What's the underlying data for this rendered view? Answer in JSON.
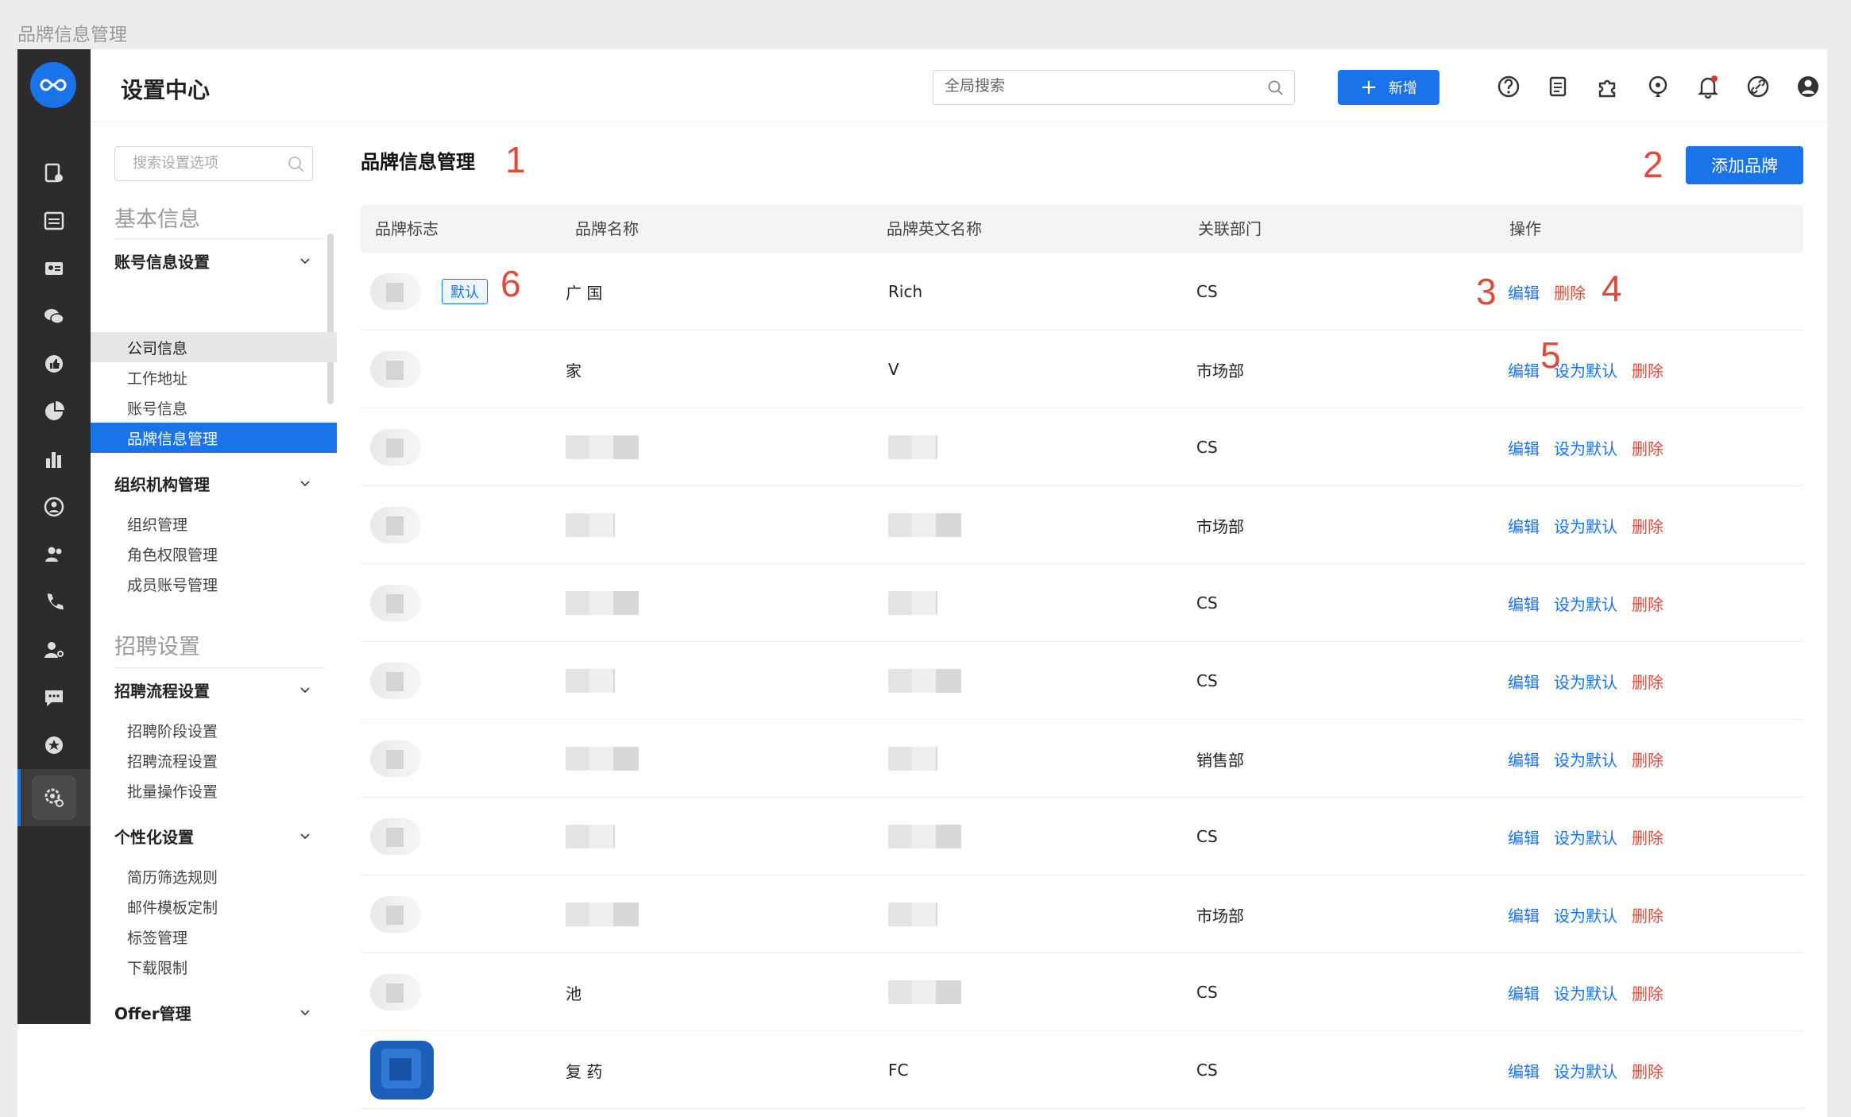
{
  "page_caption": "品牌信息管理",
  "header": {
    "title": "设置中心",
    "search_placeholder": "全局搜索",
    "new_button": "新增"
  },
  "sidebar": {
    "search_placeholder": "搜索设置选项",
    "groups": [
      {
        "title": "基本信息",
        "sections": [
          {
            "label": "账号信息设置",
            "items": [
              "公司信息",
              "工作地址",
              "账号信息",
              "品牌信息管理"
            ]
          },
          {
            "label": "组织机构管理",
            "items": [
              "组织管理",
              "角色权限管理",
              "成员账号管理"
            ]
          }
        ]
      },
      {
        "title": "招聘设置",
        "sections": [
          {
            "label": "招聘流程设置",
            "items": [
              "招聘阶段设置",
              "招聘流程设置",
              "批量操作设置"
            ]
          },
          {
            "label": "个性化设置",
            "items": [
              "简历筛选规则",
              "邮件模板定制",
              "标签管理",
              "下载限制"
            ]
          },
          {
            "label": "Offer管理",
            "items": []
          }
        ]
      }
    ]
  },
  "main": {
    "title": "品牌信息管理",
    "add_button": "添加品牌",
    "annotations": [
      "1",
      "2",
      "3",
      "4",
      "5",
      "6"
    ],
    "columns": [
      "品牌标志",
      "品牌名称",
      "品牌英文名称",
      "关联部门",
      "操作"
    ],
    "default_tag": "默认",
    "actions": {
      "edit": "编辑",
      "set_default": "设为默认",
      "delete": "删除"
    },
    "rows": [
      {
        "name": "广 国",
        "en": "Rich",
        "dept": "CS",
        "is_default": true
      },
      {
        "name": "家",
        "en": "V",
        "dept": "市场部",
        "is_default": false
      },
      {
        "name": "",
        "en": "",
        "dept": "CS",
        "is_default": false
      },
      {
        "name": "",
        "en": "",
        "dept": "市场部",
        "is_default": false
      },
      {
        "name": "",
        "en": "",
        "dept": "CS",
        "is_default": false
      },
      {
        "name": "",
        "en": "",
        "dept": "CS",
        "is_default": false
      },
      {
        "name": "",
        "en": "",
        "dept": "销售部",
        "is_default": false
      },
      {
        "name": "",
        "en": "",
        "dept": "CS",
        "is_default": false
      },
      {
        "name": "",
        "en": "",
        "dept": "市场部",
        "is_default": false
      },
      {
        "name": "池",
        "en": "",
        "dept": "CS",
        "is_default": false
      },
      {
        "name": "复 药",
        "en": "FC",
        "dept": "CS",
        "is_default": false
      }
    ]
  },
  "colors": {
    "primary": "#1a73e8",
    "danger": "#e04a3a",
    "rail": "#2c2c2c"
  }
}
